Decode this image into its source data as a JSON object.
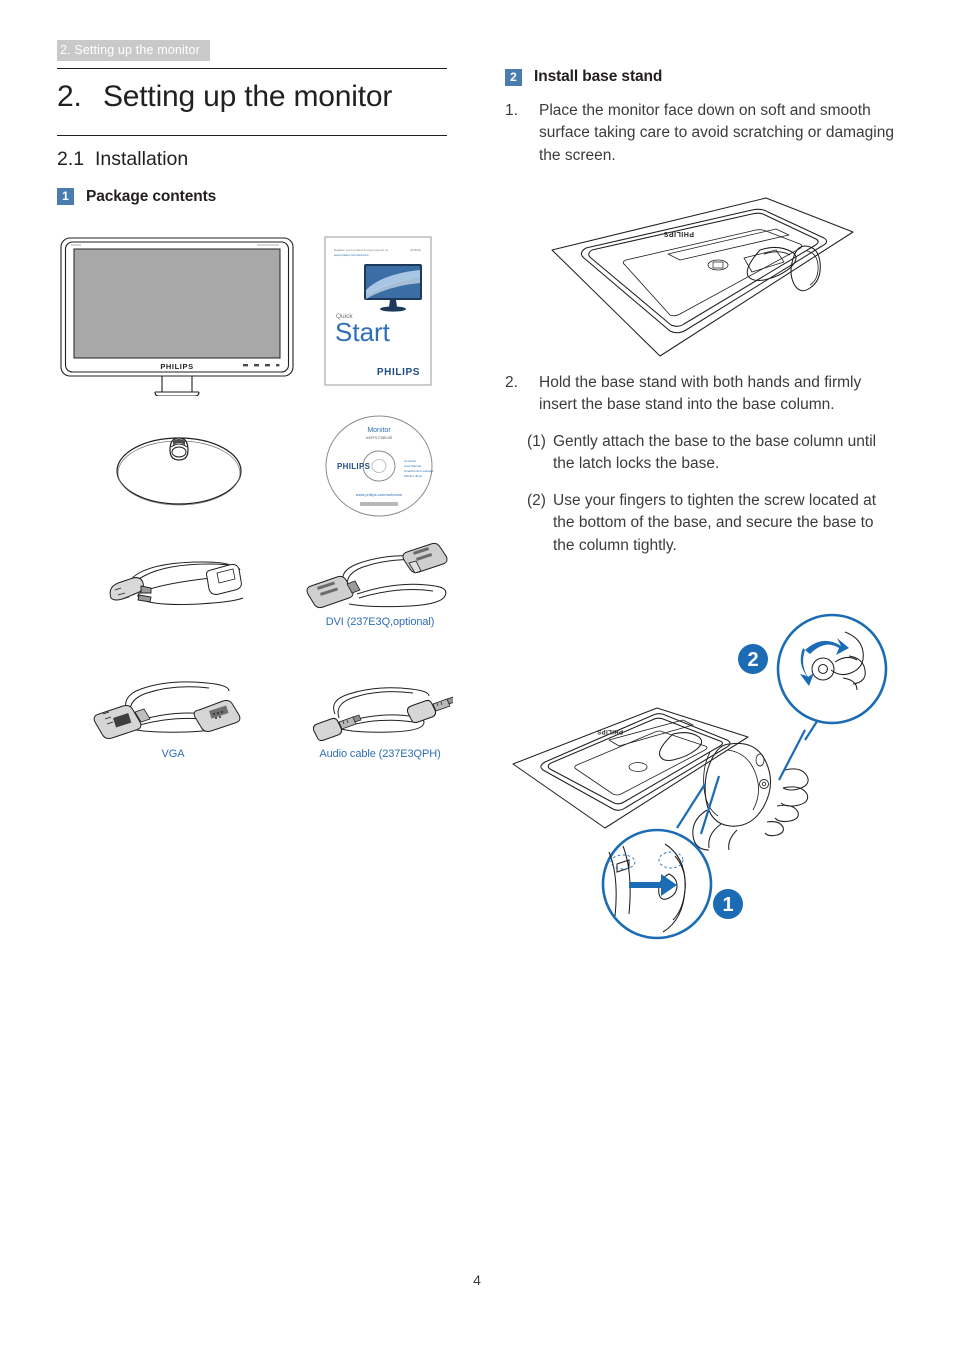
{
  "running_header": "2. Setting up the monitor",
  "chapter": {
    "number": "2.",
    "title": "Setting up the monitor"
  },
  "section": {
    "number": "2.1",
    "title": "Installation"
  },
  "left_column": {
    "subhead": {
      "badge": "1",
      "label": "Package contents"
    },
    "figures": [
      {
        "name": "monitor",
        "caption": ""
      },
      {
        "name": "quick-start-guide",
        "caption": ""
      },
      {
        "name": "base-stand",
        "caption": ""
      },
      {
        "name": "cd-rom",
        "caption": ""
      },
      {
        "name": "power-cable",
        "caption": ""
      },
      {
        "name": "dvi-cable",
        "caption": "DVI (237E3Q,optional)"
      },
      {
        "name": "vga-cable",
        "caption": "VGA"
      },
      {
        "name": "audio-cable",
        "caption": "Audio cable (237E3QPH)"
      }
    ],
    "monitor_brand": "PHILIPS",
    "quick_start": {
      "small_label": "Quick",
      "big_label": "Start",
      "brand": "PHILIPS"
    },
    "cd": {
      "title": "Monitor",
      "subtitle": "user's manual",
      "brand": "PHILIPS",
      "tagline": "www.philips.com/welcome"
    }
  },
  "right_column": {
    "subhead": {
      "badge": "2",
      "label": "Install base stand"
    },
    "steps": [
      {
        "number": "1.",
        "text": "Place the monitor face down on soft and smooth surface taking care to avoid scratching or damaging the screen."
      },
      {
        "number": "2.",
        "text": "Hold the base stand with both hands and firmly insert the base stand into the base column.",
        "sub_steps": [
          {
            "number": "(1)",
            "text": "Gently attach the base to the base column until the latch locks the base."
          },
          {
            "number": "(2)",
            "text": "Use your fingers to tighten the screw located at the bottom of the base, and secure the base to the column tightly."
          }
        ]
      }
    ],
    "figures": [
      {
        "name": "monitor-face-down-diagram",
        "callouts": []
      },
      {
        "name": "base-assembly-diagram",
        "callouts": [
          "1",
          "2"
        ]
      }
    ],
    "monitor_brand": "PHILIPS"
  },
  "page_number": "4",
  "colors": {
    "accent_blue": "#2f6fb5",
    "badge_blue": "#4a7cb0",
    "header_band": "#c9c9c9",
    "diagram_blue": "#1b6cb5",
    "line_art": "#231f20",
    "screen_gray": "#a8a8a8"
  }
}
